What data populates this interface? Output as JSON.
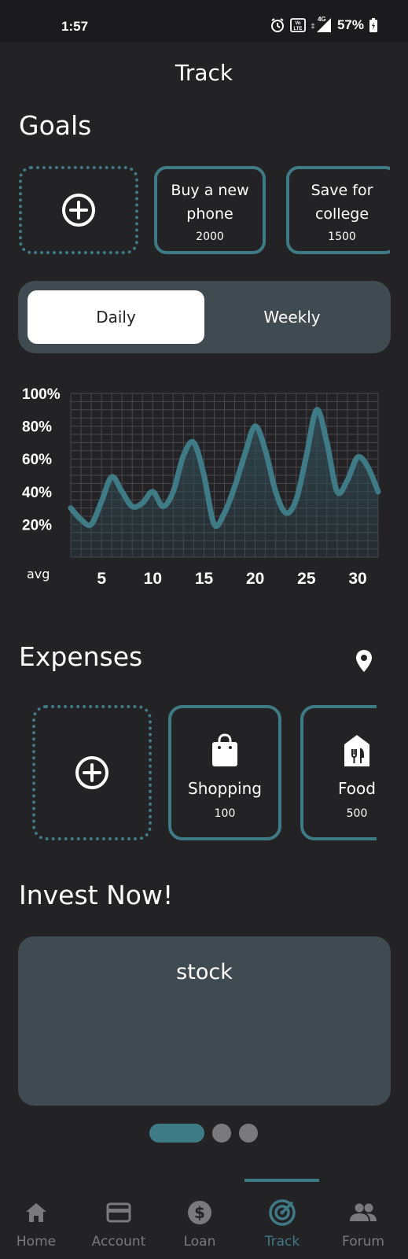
{
  "status_bar": {
    "time": "1:57",
    "battery": "57%",
    "network": "4G",
    "volte": "Vo LTE"
  },
  "header": {
    "title": "Track"
  },
  "goals": {
    "title": "Goals",
    "items": [
      {
        "title_line1": "Buy a new",
        "title_line2": "phone",
        "amount": "2000"
      },
      {
        "title_line1": "Save for",
        "title_line2": "college",
        "amount": "1500"
      }
    ]
  },
  "toggle": {
    "daily_label": "Daily",
    "weekly_label": "Weekly",
    "selected": "Daily"
  },
  "chart_data": {
    "type": "line",
    "y_tick_labels": [
      "100%",
      "80%",
      "60%",
      "40%",
      "20%"
    ],
    "x_tick_labels": [
      "5",
      "10",
      "15",
      "20",
      "25",
      "30"
    ],
    "x_axis_start_label": "avg",
    "x": [
      0,
      1,
      2,
      3,
      4,
      5,
      6,
      7,
      8,
      9,
      10,
      11,
      12,
      13,
      14,
      15,
      16,
      17,
      18,
      19,
      20,
      21,
      22,
      23,
      24,
      25,
      26,
      27,
      28,
      29,
      30
    ],
    "values": [
      30,
      23,
      20,
      34,
      49,
      40,
      31,
      33,
      40,
      31,
      40,
      62,
      70,
      50,
      20,
      27,
      43,
      63,
      80,
      65,
      40,
      27,
      35,
      62,
      90,
      70,
      40,
      47,
      61,
      55,
      40
    ],
    "ylim": [
      0,
      100
    ],
    "xlim": [
      0,
      30
    ],
    "grid": true,
    "colors": {
      "line": "#3f7a87",
      "grid": "#4a4a4e",
      "fill": "#2f4a52"
    }
  },
  "expenses": {
    "title": "Expenses",
    "items": [
      {
        "title": "Shopping",
        "amount": "100",
        "icon": "shopping-bag-icon"
      },
      {
        "title": "Food",
        "amount": "500",
        "icon": "food-icon"
      }
    ]
  },
  "invest": {
    "title": "Invest Now!",
    "card_label": "stock"
  },
  "carousel": {
    "count": 3,
    "active": 0
  },
  "nav": {
    "items": [
      {
        "label": "Home",
        "icon": "home-icon"
      },
      {
        "label": "Account",
        "icon": "card-icon"
      },
      {
        "label": "Loan",
        "icon": "dollar-icon"
      },
      {
        "label": "Track",
        "icon": "track-icon"
      },
      {
        "label": "Forum",
        "icon": "people-icon"
      }
    ],
    "active": "Track"
  },
  "colors": {
    "accent": "#3f7a87",
    "background": "#232225",
    "panel": "#3f4b51",
    "muted": "#7a7a7c"
  }
}
